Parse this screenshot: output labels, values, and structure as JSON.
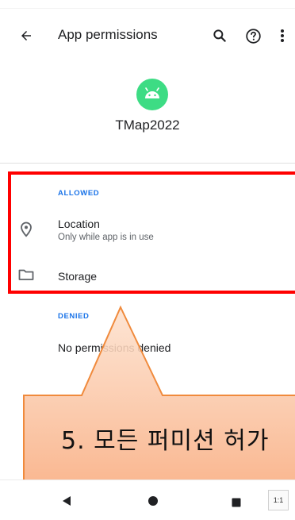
{
  "appbar": {
    "title": "App permissions"
  },
  "app": {
    "name": "TMap2022",
    "icon_color": "#3ddc84"
  },
  "sections": {
    "allowed": {
      "header": "ALLOWED",
      "items": [
        {
          "title": "Location",
          "subtitle": "Only while app is in use",
          "icon": "location-pin-icon"
        },
        {
          "title": "Storage",
          "subtitle": "",
          "icon": "folder-icon"
        }
      ]
    },
    "denied": {
      "header": "DENIED",
      "empty_text": "No permissions denied"
    }
  },
  "callout": {
    "text": "5. 모든 퍼미션 허가",
    "fill": "#f9b38a",
    "border": "#f08a3c"
  },
  "nav": {
    "scale_label": "1:1"
  },
  "colors": {
    "accent": "#1a73e8",
    "highlight": "#ff0000"
  }
}
